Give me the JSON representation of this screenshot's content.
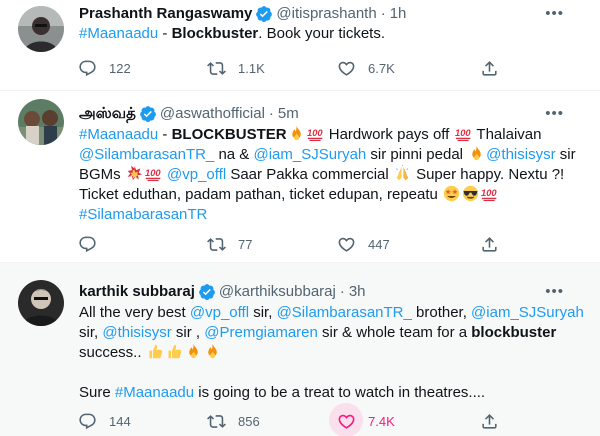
{
  "tweets": [
    {
      "name": "Prashanth Rangaswamy",
      "handle": "@itisprashanth",
      "separator": "·",
      "time": "1h",
      "more": "•••",
      "body": {
        "hashtag": "#Maanaadu",
        "dash": " - ",
        "bold": "Blockbuster",
        "rest": ". Book your tickets."
      },
      "replies": "122",
      "retweets": "1.1K",
      "likes": "6.7K"
    },
    {
      "name": "அஸ்வத்",
      "handle": "@aswathofficial",
      "separator": "·",
      "time": "5m",
      "more": "•••",
      "body": {
        "line1_hashtag": "#Maanaadu",
        "line1_dash": " - ",
        "line1_bold": "BLOCKBUSTER",
        "line1_text_a": " Hardwork pays off ",
        "line1_text_b": " Thalaivan",
        "line2_mention_a": "@SilambarasanTR_",
        "line2_text_a": " na & ",
        "line2_mention_b": "@iam_SJSuryah",
        "line2_text_b": " sir pinni pedal ",
        "line2_mention_c": "@thisisysr",
        "line2_text_c": " sir",
        "line3_text_a": "BGMs ",
        "line3_mention": "@vp_offl",
        "line3_text_b": " Saar Pakka commercial ",
        "line3_text_c": " Super happy. Nextu ?!",
        "line4_text": "Ticket eduthan, padam pathan, ticket edupan, repeatu ",
        "line5_hashtag": "#SilamabarasanTR"
      },
      "replies": "",
      "retweets": "77",
      "likes": "447"
    },
    {
      "name": "karthik subbaraj",
      "handle": "@karthiksubbaraj",
      "separator": "·",
      "time": "3h",
      "more": "•••",
      "body": {
        "line1_text_a": "All the very best ",
        "line1_mention_a": "@vp_offl",
        "line1_text_b": " sir, ",
        "line1_mention_b": "@SilambarasanTR_",
        "line1_text_c": " brother, ",
        "line1_mention_c": "@iam_SJSuryah",
        "line2_text_a": "sir, ",
        "line2_mention_a": "@thisisysr",
        "line2_text_b": " sir , ",
        "line2_mention_b": "@Premgiamaren",
        "line2_text_c": " sir & whole team for a ",
        "line2_bold": "blockbuster",
        "line3_text": "success.. ",
        "para2_text_a": "Sure ",
        "para2_hashtag": "#Maanaadu",
        "para2_text_b": " is going to be a treat to watch in theatres...."
      },
      "replies": "144",
      "retweets": "856",
      "likes": "7.4K"
    }
  ],
  "colors": {
    "link": "#1d9bf0",
    "secondary": "#536471",
    "like_active": "#f91880",
    "verified": "#1d9bf0"
  },
  "icons": [
    "reply-icon",
    "retweet-icon",
    "like-icon",
    "share-icon",
    "verified-icon"
  ]
}
